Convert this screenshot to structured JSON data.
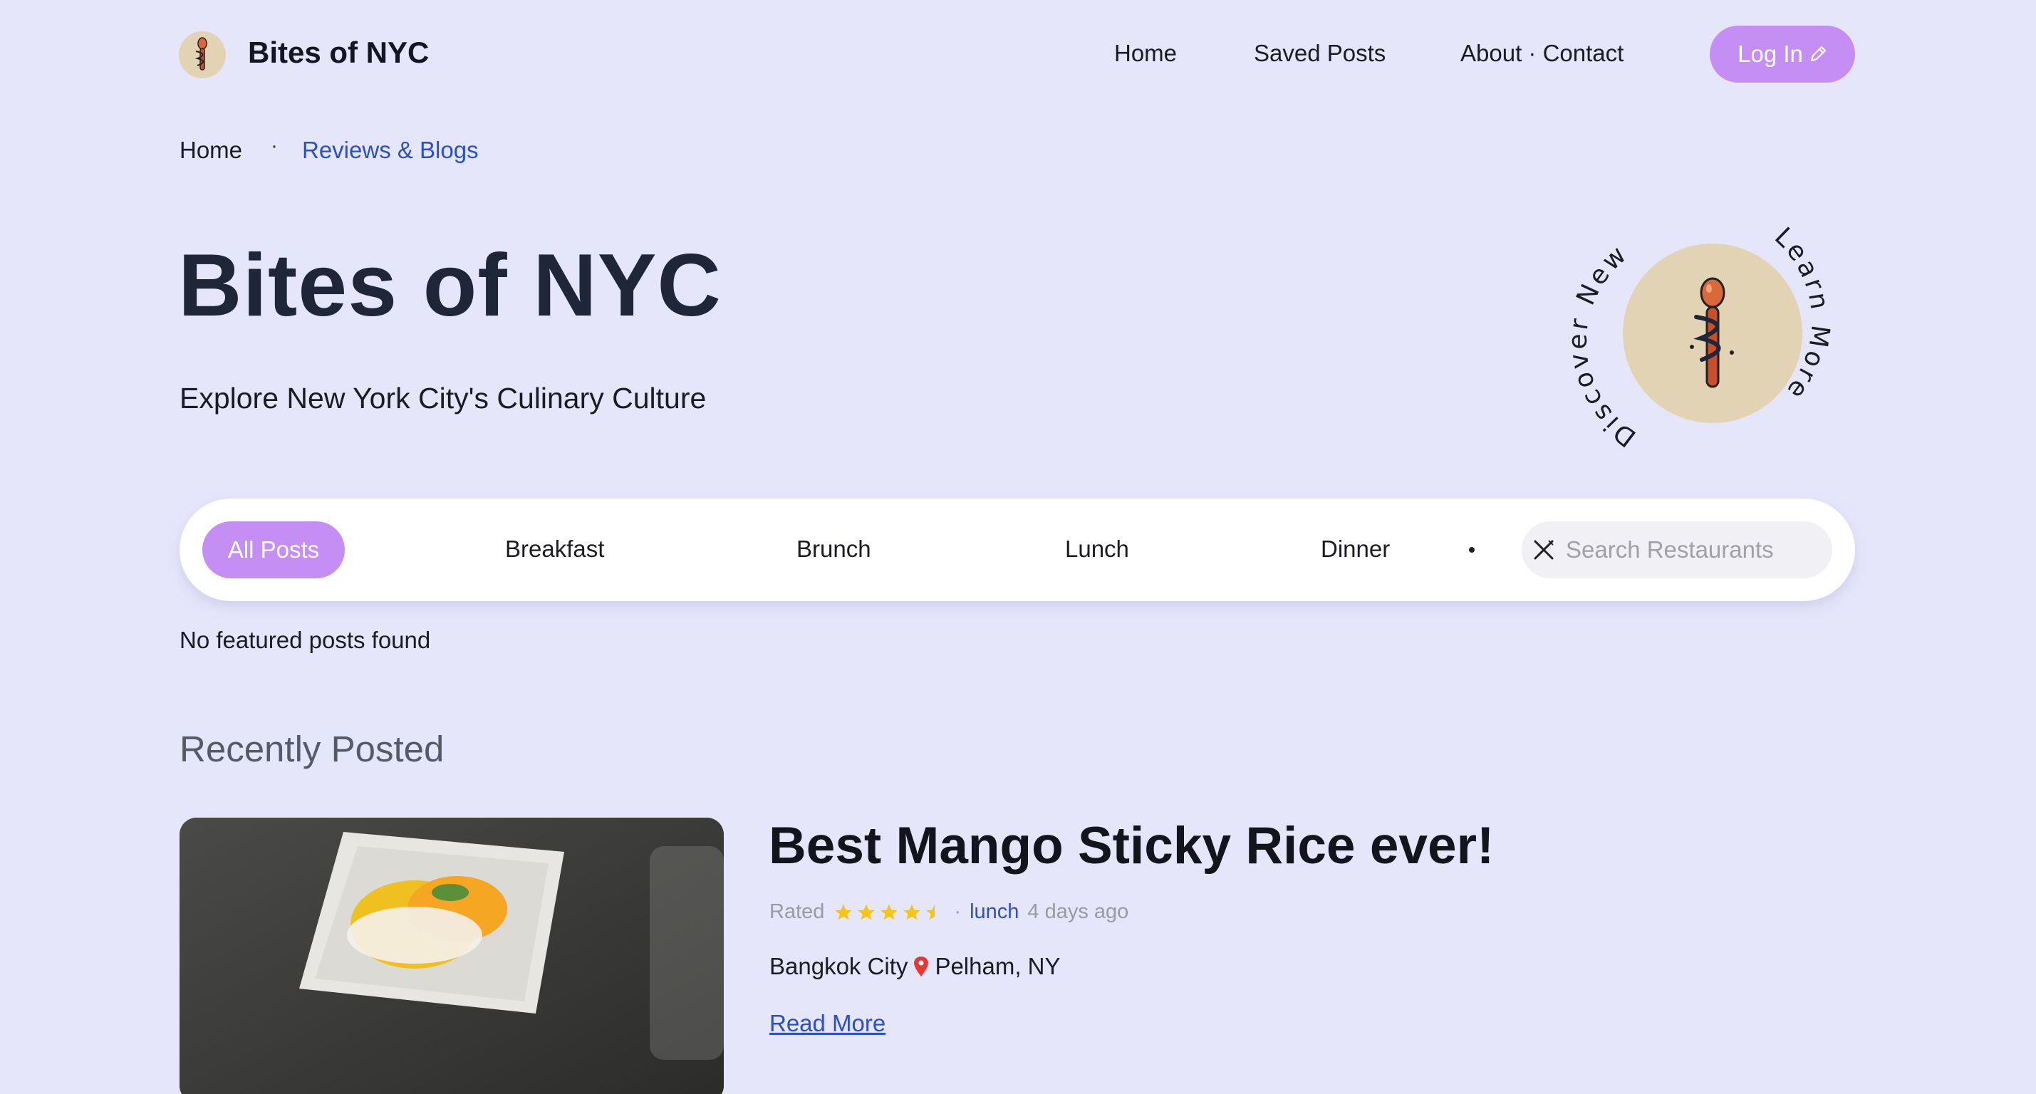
{
  "nav": {
    "brand": "Bites of NYC",
    "links": [
      "Home",
      "Saved Posts",
      "About · Contact"
    ],
    "login_label": "Log In"
  },
  "breadcrumb": {
    "home": "Home",
    "current": "Reviews & Blogs"
  },
  "hero": {
    "title": "Bites of NYC",
    "subtitle": "Explore New York City's Culinary Culture",
    "badge_left_text": "Discover New",
    "badge_right_text": "Learn More"
  },
  "filters": {
    "active": "All Posts",
    "tabs": [
      "Breakfast",
      "Brunch",
      "Lunch",
      "Dinner"
    ],
    "search_placeholder": "Search Restaurants"
  },
  "featured_empty": "No featured posts found",
  "recent": {
    "heading": "Recently Posted",
    "posts": [
      {
        "title": "Best Mango Sticky Rice ever!",
        "rated_label": "Rated",
        "rating": 4.5,
        "separator": "·",
        "category": "lunch",
        "time_ago": "4 days ago",
        "restaurant": "Bangkok City",
        "location": "Pelham, NY",
        "read_more": "Read More"
      }
    ]
  },
  "colors": {
    "background": "#e6e6fb",
    "accent": "#c48ef5",
    "link": "#2a50c4",
    "star": "#f5c518",
    "logo_bg": "#e2d3b4"
  }
}
